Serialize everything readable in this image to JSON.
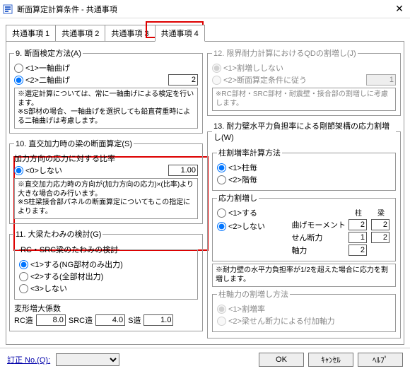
{
  "window": {
    "title": "断面算定計算条件 - 共通事項",
    "close": "✕"
  },
  "tabs": [
    "共通事項 1",
    "共通事項 2",
    "共通事項 3",
    "共通事項 4"
  ],
  "s9": {
    "legend": "9. 断面検定方法(A)",
    "r1": "<1>一軸曲げ",
    "r2": "<2>二軸曲げ",
    "val": "2",
    "note": "※選定計算については、常に一軸曲げによる検定を行います。\n※S部材の場合、一軸曲げを選択しても鉛直荷重時による二軸曲げは考慮します。"
  },
  "s10": {
    "legend": "10. 直交加力時の梁の断面算定(S)",
    "lbl": "加力方向の応力に対する比率",
    "r0": "<0>しない",
    "val": "1.00",
    "note": "※直交加力応力時の方向が(加力方向の応力)×(比率)より大きな場合のみ行います。\n※S柱梁接合部パネルの断面算定についてもこの指定によります。"
  },
  "s11": {
    "legend": "11. 大梁たわみの検討(G)",
    "sub": "RC・SRC梁のたわみの検討",
    "r1": "<1>する(NG部材のみ出力)",
    "r2": "<2>する(全部材出力)",
    "r3": "<3>しない",
    "def": "変形増大係数",
    "rc": "RC造",
    "rcv": "8.0",
    "src": "SRC造",
    "srcv": "4.0",
    "s": "S造",
    "sv": "1.0"
  },
  "s12": {
    "legend": "12. 限界耐力計算におけるQDの割増し(J)",
    "r1": "<1>割増ししない",
    "r2": "<2>断面算定条件に従う",
    "val": "1",
    "note": "※RC部材・SRC部材・耐震壁・接合部の割増しに考慮します。"
  },
  "s13": {
    "legend": "13. 耐力壁水平力負担率による剛節架構の応力割増し(W)",
    "m1": {
      "legend": "柱割増率計算方法",
      "r1": "<1>柱毎",
      "r2": "<2>階毎"
    },
    "m2": {
      "legend": "応力割増し",
      "r1": "<1>する",
      "r2": "<2>しない",
      "hc": "柱",
      "hb": "梁",
      "l1": "曲げモーメント",
      "l2": "せん断力",
      "l3": "軸力",
      "v": {
        "mc": "2",
        "mb": "2",
        "qc": "1",
        "qb": "2",
        "nc": "2"
      }
    },
    "note": "※耐力壁の水平力負担率が1/2を超えた場合に応力を割増します。",
    "m3": {
      "legend": "柱軸力の割増し方法",
      "r1": "<1>割増率",
      "r2": "<2>梁せん断力による付加軸力"
    }
  },
  "footer": {
    "rev": "訂正 No.(Q):",
    "ok": "OK",
    "cancel": "ｷｬﾝｾﾙ",
    "help": "ﾍﾙﾌﾟ"
  }
}
